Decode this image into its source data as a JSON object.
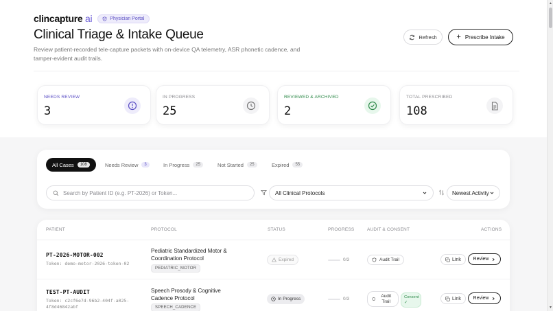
{
  "brand": {
    "name": "clincapture",
    "suffix": "ai",
    "portal_badge": "Physician Portal"
  },
  "header": {
    "title": "Clinical Triage & Intake Queue",
    "description": "Review patient-recorded tele-capture packets with on-device QA telemetry, ASR phonetic cadence, and tamper-evident audit trails.",
    "refresh_label": "Refresh",
    "prescribe_label": "Prescribe Intake"
  },
  "stats": [
    {
      "label": "NEEDS REVIEW",
      "value": "3",
      "icon": "alert-circle-icon",
      "label_color": "#5b4fc4"
    },
    {
      "label": "IN PROGRESS",
      "value": "25",
      "icon": "clock-icon",
      "label_color": "#8a8a8f"
    },
    {
      "label": "REVIEWED & ARCHIVED",
      "value": "2",
      "icon": "check-circle-icon",
      "label_color": "#2f8a4a"
    },
    {
      "label": "TOTAL PRESCRIBED",
      "value": "108",
      "icon": "document-icon",
      "label_color": "#8a8a8f"
    }
  ],
  "tabs": [
    {
      "label": "All Cases",
      "count": "108"
    },
    {
      "label": "Needs Review",
      "count": "3"
    },
    {
      "label": "In Progress",
      "count": "25"
    },
    {
      "label": "Not Started",
      "count": "25"
    },
    {
      "label": "Expired",
      "count": "55"
    }
  ],
  "filters": {
    "search_placeholder": "Search by Patient ID (e.g. PT-2026) or Token...",
    "protocol_selected": "All Clinical Protocols",
    "sort_selected": "Newest Activity"
  },
  "table": {
    "headers": [
      "PATIENT",
      "PROTOCOL",
      "STATUS",
      "PROGRESS",
      "AUDIT & CONSENT",
      "ACTIONS"
    ],
    "rows": [
      {
        "patient_id": "PT-2026-MOTOR-002",
        "token": "Token: demo-motor-2026-token-02",
        "protocol": "Pediatric Standardized Motor & Coordination Protocol",
        "protocol_tag": "PEDIATRIC_MOTOR",
        "status": "Expired",
        "progress": "0/3",
        "audit": "Audit Trail",
        "consent": "",
        "link_label": "Link",
        "review_label": "Review"
      },
      {
        "patient_id": "TEST-PT-AUDIT",
        "token": "Token: c2cf6e7d-96b2-404f-a025-4f8d46842abf",
        "protocol": "Speech Prosody & Cognitive Cadence Protocol",
        "protocol_tag": "SPEECH_CADENCE",
        "status": "In Progress",
        "progress": "0/3",
        "audit": "Audit Trail",
        "consent": "Consent ✓",
        "link_label": "Link",
        "review_label": "Review"
      }
    ]
  }
}
